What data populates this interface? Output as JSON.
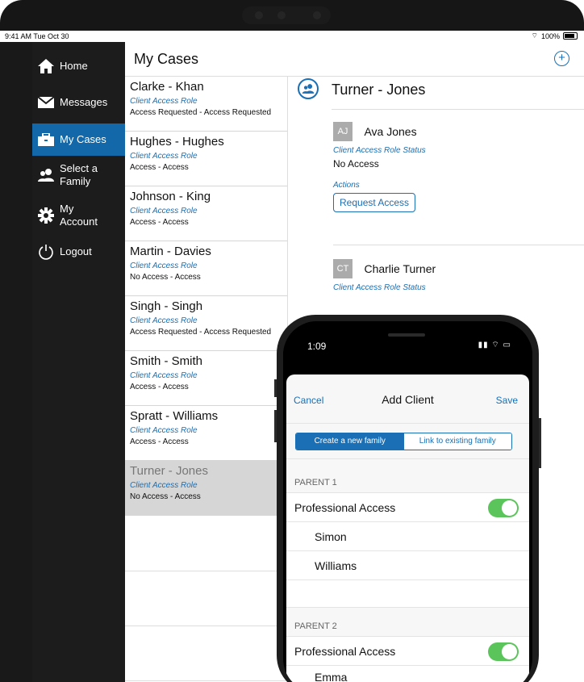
{
  "status": {
    "time": "9:41 AM  Tue Oct 30",
    "battery": "100%"
  },
  "sidebar": {
    "items": [
      {
        "label": "Home",
        "icon": "home-icon"
      },
      {
        "label": "Messages",
        "icon": "envelope-icon"
      },
      {
        "label": "My Cases",
        "icon": "briefcase-icon"
      },
      {
        "label": "Select a Family",
        "icon": "family-icon"
      },
      {
        "label": "My Account",
        "icon": "gear-icon"
      },
      {
        "label": "Logout",
        "icon": "power-icon"
      }
    ]
  },
  "header": {
    "title": "My Cases"
  },
  "cases": [
    {
      "name": "Clarke - Khan",
      "role": "Client Access Role",
      "status": "Access Requested - Access Requested"
    },
    {
      "name": "Hughes - Hughes",
      "role": "Client Access Role",
      "status": "Access - Access"
    },
    {
      "name": "Johnson - King",
      "role": "Client Access Role",
      "status": "Access - Access"
    },
    {
      "name": "Martin - Davies",
      "role": "Client Access Role",
      "status": "No Access - Access"
    },
    {
      "name": "Singh - Singh",
      "role": "Client Access Role",
      "status": "Access Requested - Access Requested"
    },
    {
      "name": "Smith - Smith",
      "role": "Client Access Role",
      "status": "Access - Access"
    },
    {
      "name": "Spratt - Williams",
      "role": "Client Access Role",
      "status": "Access - Access"
    },
    {
      "name": "Turner - Jones",
      "role": "Client Access Role",
      "status": "No Access - Access"
    }
  ],
  "detail": {
    "family": "Turner - Jones",
    "members": [
      {
        "initials": "AJ",
        "name": "Ava Jones",
        "role_label": "Client Access Role Status",
        "status": "No Access",
        "actions_label": "Actions",
        "button": "Request Access"
      },
      {
        "initials": "CT",
        "name": "Charlie Turner",
        "role_label": "Client Access Role Status"
      }
    ]
  },
  "phone": {
    "time": "1:09",
    "cancel": "Cancel",
    "title": "Add Client",
    "save": "Save",
    "segments": [
      "Create a new family",
      "Link to existing family"
    ],
    "parent1": {
      "header": "PARENT 1",
      "access_label": "Professional Access",
      "first_name": "Simon",
      "last_name": "Williams",
      "access_on": true
    },
    "parent2": {
      "header": "PARENT 2",
      "access_label": "Professional Access",
      "first_name": "Emma",
      "access_on": true
    }
  },
  "colors": {
    "accent": "#1a6fb5",
    "sidebar": "#1c1c1c",
    "active": "#1268a8",
    "toggle": "#5bc45b"
  }
}
